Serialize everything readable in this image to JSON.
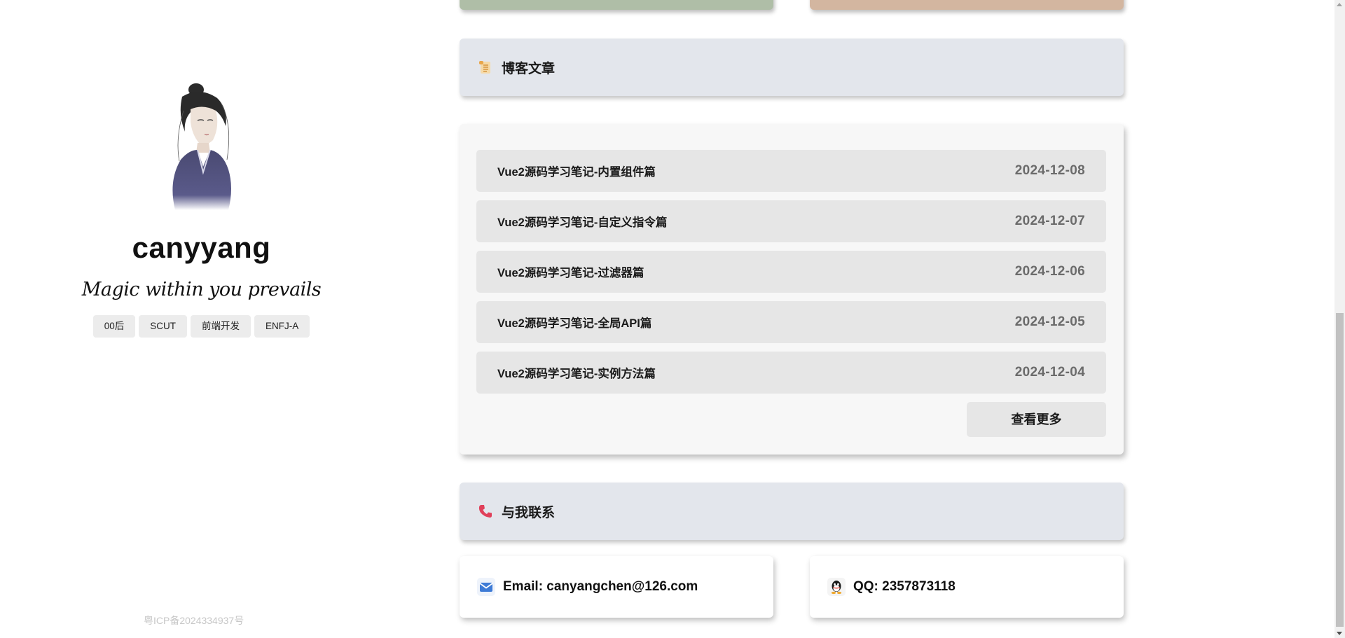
{
  "profile": {
    "name": "canyyang",
    "motto": "Magic within you prevails",
    "tags": [
      "00后",
      "SCUT",
      "前端开发",
      "ENFJ-A"
    ],
    "icp": "粤ICP备2024334937号"
  },
  "blog": {
    "header_title": "博客文章",
    "header_icon": "scroll-icon",
    "posts": [
      {
        "title": "Vue2源码学习笔记-内置组件篇",
        "date": "2024-12-08"
      },
      {
        "title": "Vue2源码学习笔记-自定义指令篇",
        "date": "2024-12-07"
      },
      {
        "title": "Vue2源码学习笔记-过滤器篇",
        "date": "2024-12-06"
      },
      {
        "title": "Vue2源码学习笔记-全局API篇",
        "date": "2024-12-05"
      },
      {
        "title": "Vue2源码学习笔记-实例方法篇",
        "date": "2024-12-04"
      }
    ],
    "more_label": "查看更多"
  },
  "contact": {
    "header_title": "与我联系",
    "header_icon": "phone-icon",
    "email": "Email: canyangchen@126.com",
    "qq": "QQ: 2357873118"
  },
  "colors": {
    "green_card": "#afbea7",
    "tan_card": "#d3b6a0",
    "header_bg": "#e3e6ec",
    "post_bg": "#e6e6e6"
  }
}
